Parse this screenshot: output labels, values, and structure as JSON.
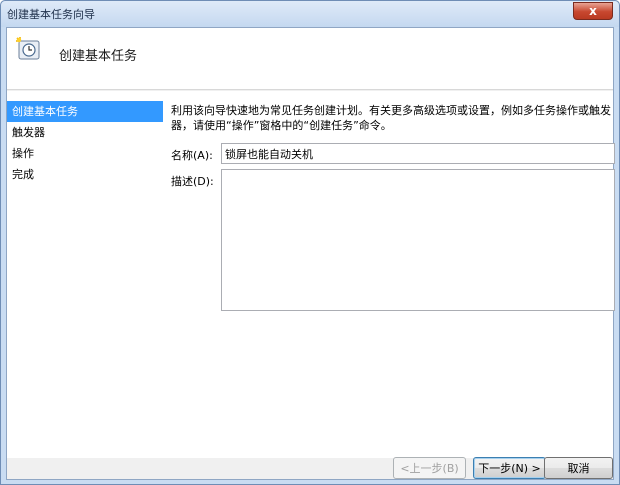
{
  "window": {
    "title": "创建基本任务向导",
    "close_glyph": "x"
  },
  "header": {
    "title": "创建基本任务",
    "icon": "task-clock-icon"
  },
  "sidebar": {
    "items": [
      {
        "label": "创建基本任务",
        "active": true
      },
      {
        "label": "触发器",
        "active": false
      },
      {
        "label": "操作",
        "active": false
      },
      {
        "label": "完成",
        "active": false
      }
    ]
  },
  "main": {
    "description": "利用该向导快速地为常见任务创建计划。有关更多高级选项或设置，例如多任务操作或触发器，请使用“操作”窗格中的“创建任务”命令。",
    "name_label": "名称(A):",
    "name_value": "锁屏也能自动关机",
    "desc_label": "描述(D):",
    "desc_value": ""
  },
  "buttons": {
    "back": "<上一步(B)",
    "next": "下一步(N) >",
    "cancel": "取消"
  },
  "colors": {
    "selection": "#3399ff",
    "frame": "#c9dcf2"
  }
}
